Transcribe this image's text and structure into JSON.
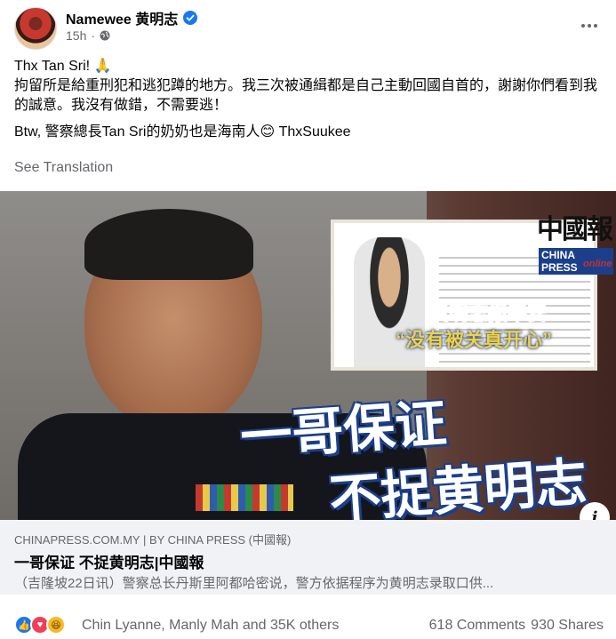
{
  "post": {
    "author": "Namewee 黄明志",
    "time": "15h",
    "text_lines": [
      "Thx Tan Sri! 🙏",
      "拘留所是給重刑犯和逃犯蹲的地方。我三次被通緝都是自己主動回國自首的，謝謝你們看到我的誠意。我沒有做錯，不需要逃！",
      "Btw, 警察總長Tan Sri的奶奶也是海南人😊 ThxSuukee"
    ],
    "see_translation": "See Translation"
  },
  "image": {
    "headline_line1": "一哥保证",
    "headline_line2": "不捉黄明志",
    "inset_caption1": "黄明志报平安",
    "inset_caption2": "“没有被关真开心”",
    "logo_cn": "中國報",
    "logo_en": "CHINA PRESS",
    "logo_online": "online"
  },
  "link": {
    "domain": "CHINAPRESS.COM.MY | BY CHINA PRESS (中國報)",
    "title": "一哥保证 不捉黄明志|中國報",
    "description": "（吉隆坡22日讯）警察总长丹斯里阿都哈密说，警方依据程序为黄明志录取口供..."
  },
  "reactions": {
    "names": "Chin Lyanne, Manly Mah and 35K others",
    "comments": "618 Comments",
    "shares": "930 Shares"
  },
  "colors": {
    "verified": "#1877f2",
    "like": "#1877f2",
    "love": "#f33e58",
    "haha": "#f7b928"
  },
  "icons": [
    "verified-badge-icon",
    "globe-icon",
    "more-options-icon",
    "info-icon",
    "like-reaction-icon",
    "love-reaction-icon",
    "haha-reaction-icon"
  ]
}
